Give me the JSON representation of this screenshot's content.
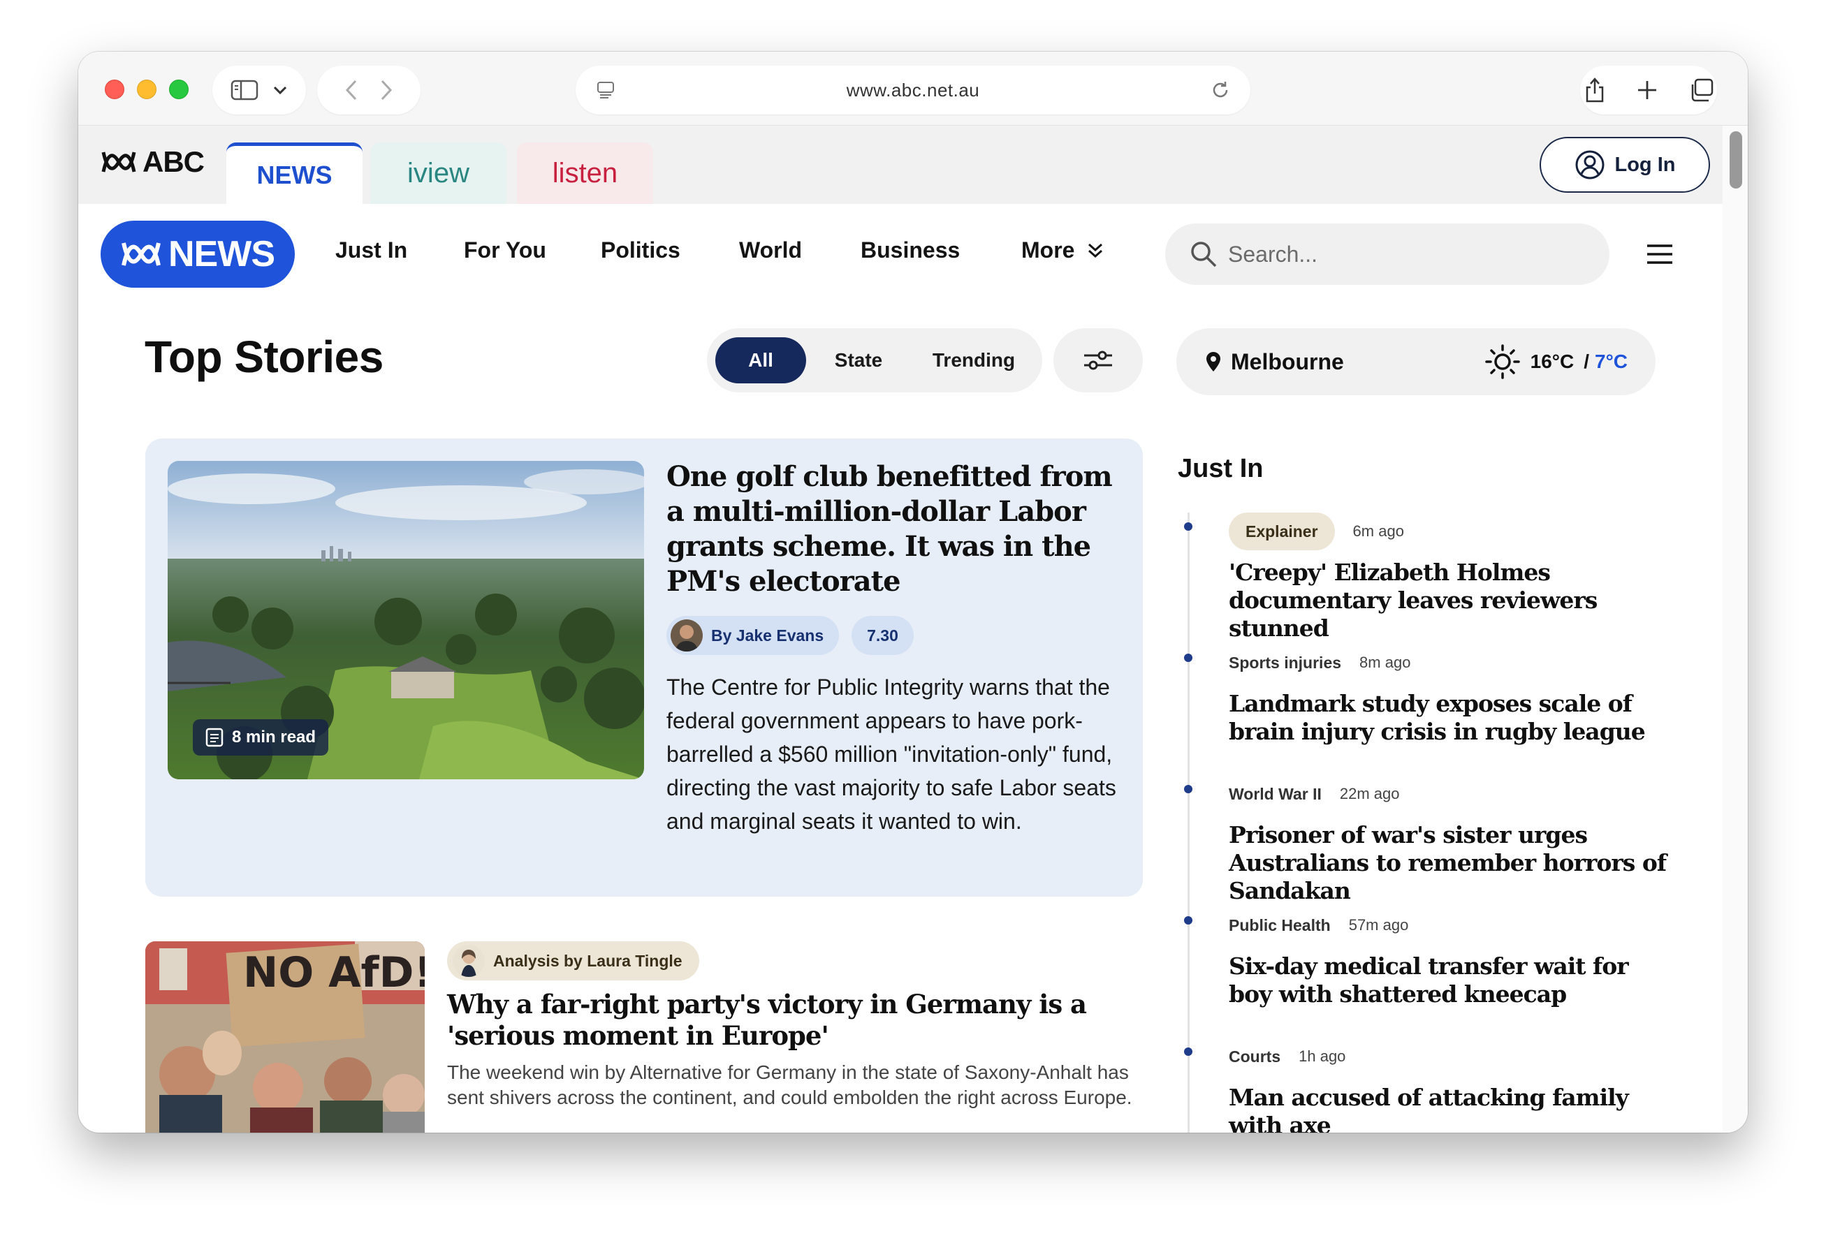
{
  "browser": {
    "url": "www.abc.net.au"
  },
  "network": {
    "logo": "ABC",
    "tabs": [
      {
        "label": "NEWS"
      },
      {
        "label": "iview"
      },
      {
        "label": "listen"
      }
    ],
    "login": "Log In"
  },
  "news_nav": {
    "logo": "NEWS",
    "items": [
      "Just In",
      "For You",
      "Politics",
      "World",
      "Business",
      "More"
    ],
    "search_placeholder": "Search..."
  },
  "top_stories": {
    "title": "Top Stories",
    "filters": [
      "All",
      "State",
      "Trending"
    ],
    "selected_filter": "All"
  },
  "weather": {
    "location": "Melbourne",
    "high": "16°C",
    "separator": "/",
    "low": "7°C"
  },
  "feature": {
    "read_time": "8 min read",
    "headline": "One golf club benefitted from a multi-million-dollar Labor grants scheme. It was in the PM's electorate",
    "author": "By Jake Evans",
    "program": "7.30",
    "summary": "The Centre for Public Integrity warns that the federal government appears to have pork-barrelled a $560 million \"invitation-only\" fund, directing the vast majority to safe Labor seats and marginal seats it wanted to win."
  },
  "story2": {
    "label": "Analysis by Laura Tingle",
    "headline": "Why a far-right party's victory in Germany is a 'serious moment in Europe'",
    "summary": "The weekend win by Alternative for Germany in the state of Saxony-Anhalt has sent shivers across the continent, and could embolden the right across Europe.",
    "sign_text": "NO AfD!"
  },
  "just_in": {
    "title": "Just In",
    "items": [
      {
        "tag": "Explainer",
        "time": "6m ago",
        "headline": "'Creepy' Elizabeth Holmes documentary leaves reviewers stunned"
      },
      {
        "tag": "Sports injuries",
        "time": "8m ago",
        "headline": "Landmark study exposes scale of brain injury crisis in rugby league"
      },
      {
        "tag": "World War II",
        "time": "22m ago",
        "headline": "Prisoner of war's sister urges Australians to remember horrors of Sandakan"
      },
      {
        "tag": "Public Health",
        "time": "57m ago",
        "headline": "Six-day medical transfer wait for boy with shattered kneecap"
      },
      {
        "tag": "Courts",
        "time": "1h ago",
        "headline": "Man accused of attacking family with axe"
      }
    ]
  },
  "colors": {
    "brand_blue": "#1e53da",
    "navy": "#15295c",
    "card_bg": "#e7eef8",
    "iview": "#2a8680",
    "listen": "#c8213f"
  }
}
